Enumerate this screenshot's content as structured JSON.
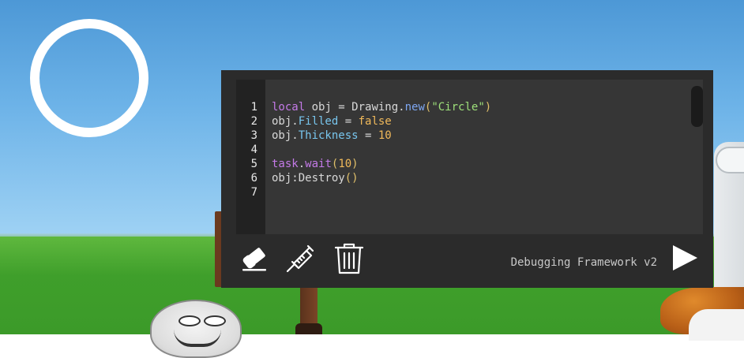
{
  "editor": {
    "line_numbers": [
      "1",
      "2",
      "3",
      "4",
      "5",
      "6",
      "7"
    ],
    "lines": [
      [
        {
          "t": "local",
          "c": "kw"
        },
        {
          "t": " obj = Drawing.",
          "c": ""
        },
        {
          "t": "new",
          "c": "fn"
        },
        {
          "t": "(",
          "c": "punc"
        },
        {
          "t": "\"Circle\"",
          "c": "str"
        },
        {
          "t": ")",
          "c": "punc"
        }
      ],
      [
        {
          "t": "obj.",
          "c": ""
        },
        {
          "t": "Filled",
          "c": "prop"
        },
        {
          "t": " = ",
          "c": ""
        },
        {
          "t": "false",
          "c": "bool"
        }
      ],
      [
        {
          "t": "obj.",
          "c": ""
        },
        {
          "t": "Thickness",
          "c": "prop"
        },
        {
          "t": " = ",
          "c": ""
        },
        {
          "t": "10",
          "c": "num"
        }
      ],
      [],
      [
        {
          "t": "task",
          "c": "kw"
        },
        {
          "t": ".",
          "c": ""
        },
        {
          "t": "wait",
          "c": "kw"
        },
        {
          "t": "(",
          "c": "punc"
        },
        {
          "t": "10",
          "c": "num"
        },
        {
          "t": ")",
          "c": "punc"
        }
      ],
      [
        {
          "t": "obj:Destroy",
          "c": ""
        },
        {
          "t": "()",
          "c": "punc"
        }
      ],
      []
    ]
  },
  "toolbar": {
    "eraser_icon": "eraser-icon",
    "inject_icon": "syringe-icon",
    "trash_icon": "trash-icon",
    "run_icon": "play-icon"
  },
  "footer": {
    "label": "Debugging Framework v2"
  },
  "colors": {
    "panel_bg": "#2b2b2b",
    "editor_bg": "#363636",
    "gutter_bg": "#222222",
    "keyword": "#c47ae8",
    "string": "#9ee07a",
    "number": "#f0b95a",
    "property": "#78c6ee"
  }
}
